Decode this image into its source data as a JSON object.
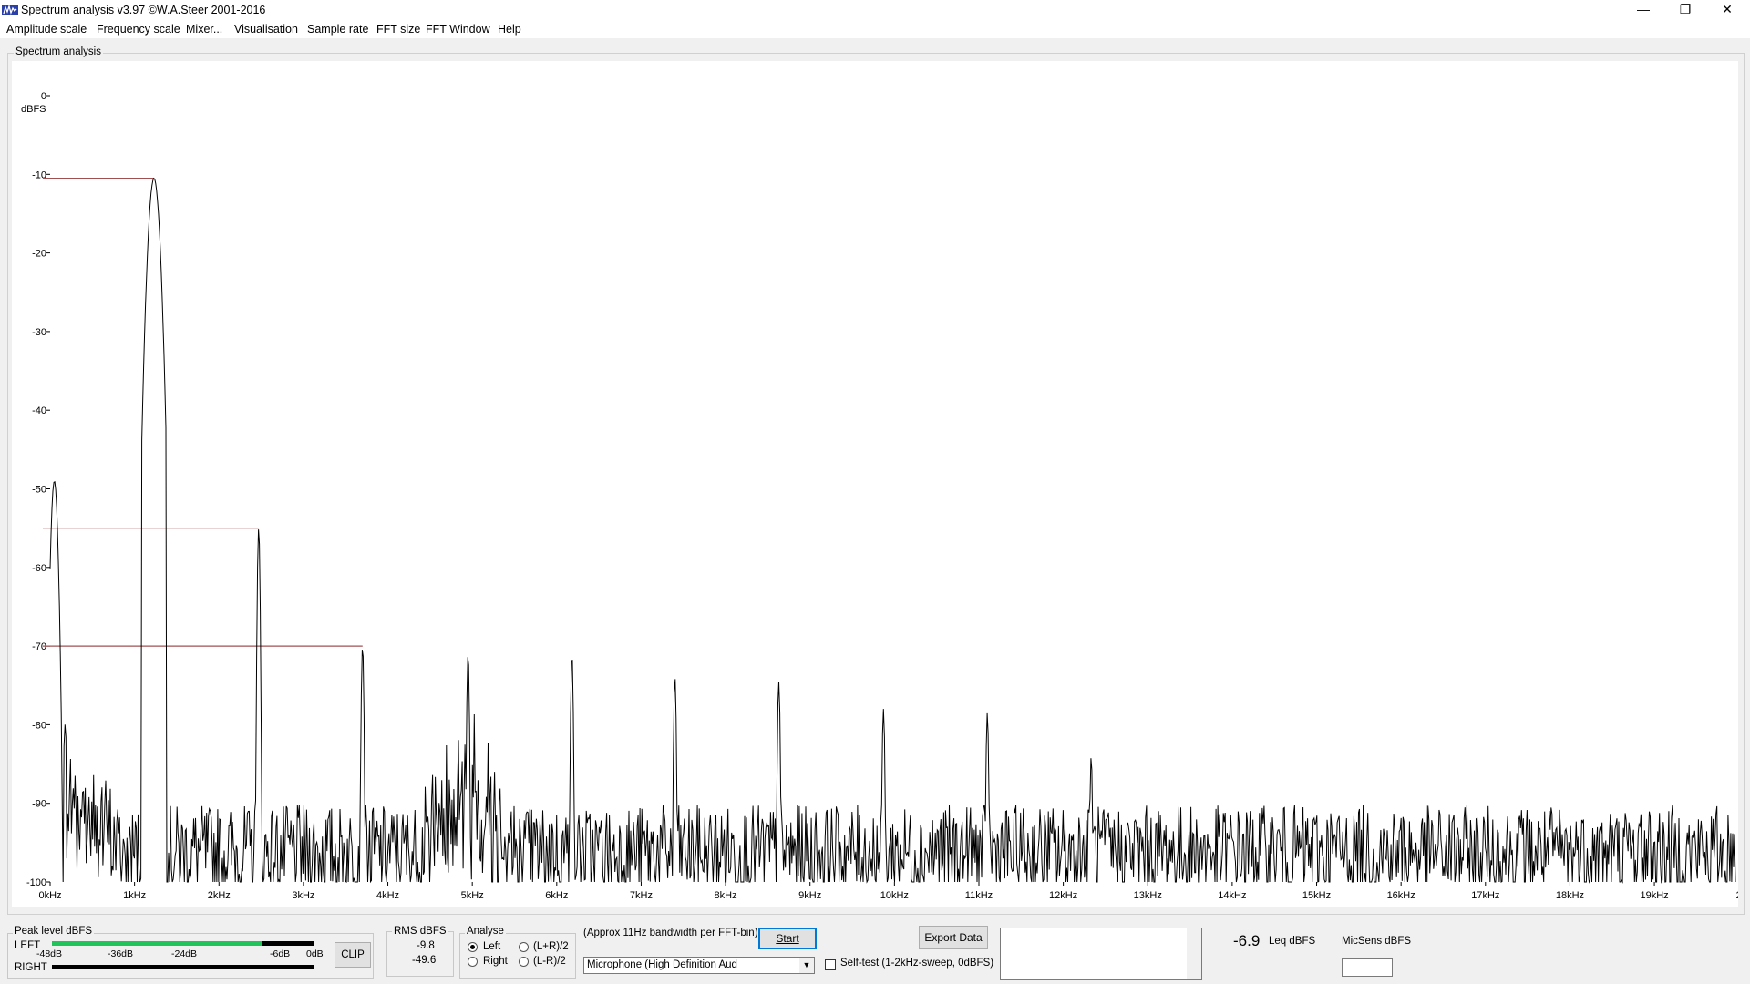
{
  "window": {
    "title": "Spectrum analysis v3.97  ©W.A.Steer 2001-2016",
    "minimize": "—",
    "maximize": "❐",
    "close": "✕"
  },
  "menu": [
    "Amplitude scale",
    "Frequency scale",
    "Mixer...",
    "Visualisation",
    "Sample rate",
    "FFT size",
    "FFT Window",
    "Help"
  ],
  "spectrum": {
    "group_label": "Spectrum analysis",
    "y_unit": "dBFS",
    "y_ticks": [
      "0",
      "-10",
      "-20",
      "-30",
      "-40",
      "-50",
      "-60",
      "-70",
      "-80",
      "-90",
      "-100"
    ],
    "x_ticks": [
      "0kHz",
      "1kHz",
      "2kHz",
      "3kHz",
      "4kHz",
      "5kHz",
      "6kHz",
      "7kHz",
      "8kHz",
      "9kHz",
      "10kHz",
      "11kHz",
      "12kHz",
      "13kHz",
      "14kHz",
      "15kHz",
      "16kHz",
      "17kHz",
      "18kHz",
      "19kHz",
      "2"
    ],
    "trace_color": "#000000",
    "marker_color": "#a05050",
    "background": "#ffffff"
  },
  "chart_data": {
    "type": "line",
    "xlabel": "",
    "ylabel": "dBFS",
    "xlim_khz": [
      0,
      20
    ],
    "ylim": [
      -100,
      0
    ],
    "noise_floor_db": -95,
    "peaks": [
      {
        "freq_khz": 0.05,
        "db": -49
      },
      {
        "freq_khz": 1.23,
        "db": -10.5
      },
      {
        "freq_khz": 2.47,
        "db": -55
      },
      {
        "freq_khz": 3.7,
        "db": -70
      },
      {
        "freq_khz": 4.95,
        "db": -71
      },
      {
        "freq_khz": 6.18,
        "db": -71
      },
      {
        "freq_khz": 7.4,
        "db": -74
      },
      {
        "freq_khz": 8.63,
        "db": -74.5
      },
      {
        "freq_khz": 9.87,
        "db": -78
      },
      {
        "freq_khz": 11.1,
        "db": -78.5
      },
      {
        "freq_khz": 12.33,
        "db": -84
      }
    ],
    "peak_markers": [
      {
        "db": -10.5,
        "to_khz": 1.23
      },
      {
        "db": -55,
        "to_khz": 2.47
      },
      {
        "db": -70,
        "to_khz": 3.7
      }
    ]
  },
  "peak_level": {
    "label": "Peak level dBFS",
    "left_label": "LEFT",
    "right_label": "RIGHT",
    "scale": [
      "-48dB",
      "-36dB",
      "-24dB",
      "-6dB",
      "0dB"
    ],
    "left_fill_fraction": 0.8,
    "right_fill_fraction": 0.0,
    "clip_label": "CLIP"
  },
  "rms": {
    "label": "RMS dBFS",
    "left_value": "-9.8",
    "right_value": "-49.6"
  },
  "analyse": {
    "label": "Analyse",
    "options": [
      "Left",
      "Right",
      "(L+R)/2",
      "(L-R)/2"
    ],
    "selected": "Left"
  },
  "controls": {
    "bandwidth_note": "(Approx 11Hz bandwidth per FFT-bin)",
    "start_label": "Start",
    "device": "Microphone (High Definition Aud",
    "selftest_label": "Self-test  (1-2kHz-sweep, 0dBFS)",
    "export_label": "Export Data"
  },
  "leq": {
    "value": "-6.9",
    "unit": "Leq dBFS"
  },
  "micsens": {
    "label": "MicSens dBFS",
    "value": ""
  }
}
